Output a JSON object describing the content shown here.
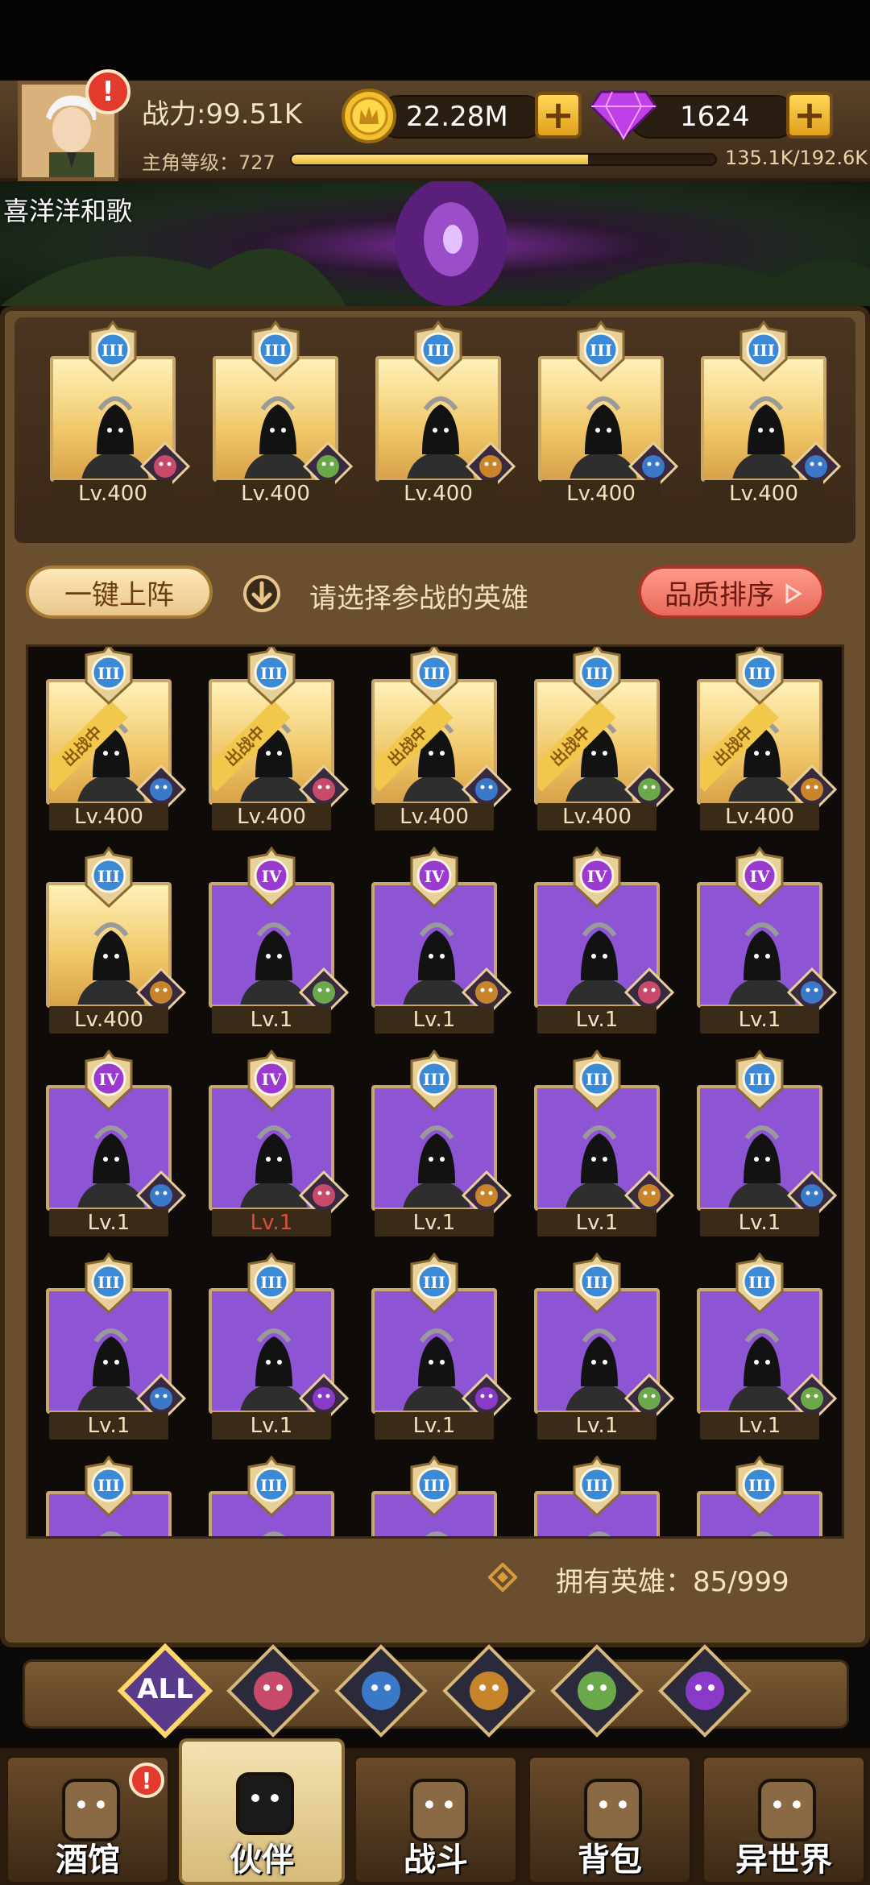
{
  "header": {
    "power": "战力:99.51K",
    "gold": "22.28M",
    "gems": "1624",
    "level_label": "主角等级：727",
    "xp_text": "135.1K/192.6K",
    "xp_fraction": 0.7,
    "player_name": "喜洋洋和歌"
  },
  "toolbar": {
    "auto_deploy": "一键上阵",
    "hint": "请选择参战的英雄",
    "sort": "品质排序"
  },
  "colors": {
    "gold_bg": "#f0c768",
    "purple_bg": "#8d55d4",
    "accent": "#e86a5a"
  },
  "deployed_tag": "出战中",
  "formation": [
    {
      "lv": "Lv.400",
      "rank": "III",
      "faction": "knight",
      "hero": "armored-knight"
    },
    {
      "lv": "Lv.400",
      "rank": "III",
      "faction": "elf",
      "hero": "elf-ranger"
    },
    {
      "lv": "Lv.400",
      "rank": "III",
      "faction": "beast",
      "hero": "pharaoh"
    },
    {
      "lv": "Lv.400",
      "rank": "III",
      "faction": "fishman",
      "hero": "serpent-shadow"
    },
    {
      "lv": "Lv.400",
      "rank": "III",
      "faction": "fishman",
      "hero": "blue-hair-mage"
    }
  ],
  "heroes": [
    {
      "lv": "Lv.400",
      "rank": "III",
      "bg": "gold",
      "deployed": true,
      "faction": "fishman",
      "hero": "serpent-shadow"
    },
    {
      "lv": "Lv.400",
      "rank": "III",
      "bg": "gold",
      "deployed": true,
      "faction": "knight",
      "hero": "armored-knight"
    },
    {
      "lv": "Lv.400",
      "rank": "III",
      "bg": "gold",
      "deployed": true,
      "faction": "fishman",
      "hero": "blue-hair-mage"
    },
    {
      "lv": "Lv.400",
      "rank": "III",
      "bg": "gold",
      "deployed": true,
      "faction": "elf",
      "hero": "elf-ranger"
    },
    {
      "lv": "Lv.400",
      "rank": "III",
      "bg": "gold",
      "deployed": true,
      "faction": "beast",
      "hero": "pharaoh"
    },
    {
      "lv": "Lv.400",
      "rank": "III",
      "bg": "gold",
      "deployed": false,
      "faction": "beast",
      "hero": "pharaoh"
    },
    {
      "lv": "Lv.1",
      "rank": "IV",
      "bg": "purple",
      "deployed": false,
      "faction": "elf",
      "hero": "stone-golem"
    },
    {
      "lv": "Lv.1",
      "rank": "IV",
      "bg": "purple",
      "deployed": false,
      "faction": "beast",
      "hero": "spiked-warrior"
    },
    {
      "lv": "Lv.1",
      "rank": "IV",
      "bg": "purple",
      "deployed": false,
      "faction": "knight",
      "hero": "feather-hat"
    },
    {
      "lv": "Lv.1",
      "rank": "IV",
      "bg": "purple",
      "deployed": false,
      "faction": "fishman",
      "hero": "blue-hood"
    },
    {
      "lv": "Lv.1",
      "rank": "IV",
      "bg": "purple",
      "deployed": false,
      "faction": "fishman",
      "hero": "blue-hood"
    },
    {
      "lv": "Lv.1",
      "rank": "IV",
      "bg": "purple",
      "deployed": false,
      "faction": "knight",
      "hero": "roman-soldier",
      "lv_red": true
    },
    {
      "lv": "Lv.1",
      "rank": "III",
      "bg": "purple",
      "deployed": false,
      "faction": "beast",
      "hero": "horse-warrior"
    },
    {
      "lv": "Lv.1",
      "rank": "III",
      "bg": "purple",
      "deployed": false,
      "faction": "beast",
      "hero": "horse-warrior"
    },
    {
      "lv": "Lv.1",
      "rank": "III",
      "bg": "purple",
      "deployed": false,
      "faction": "fishman",
      "hero": "long-hair-elder"
    },
    {
      "lv": "Lv.1",
      "rank": "III",
      "bg": "purple",
      "deployed": false,
      "faction": "fishman",
      "hero": "long-hair-elder"
    },
    {
      "lv": "Lv.1",
      "rank": "III",
      "bg": "purple",
      "deployed": false,
      "faction": "demon",
      "hero": "dark-knight"
    },
    {
      "lv": "Lv.1",
      "rank": "III",
      "bg": "purple",
      "deployed": false,
      "faction": "demon",
      "hero": "dark-knight"
    },
    {
      "lv": "Lv.1",
      "rank": "III",
      "bg": "purple",
      "deployed": false,
      "faction": "elf",
      "hero": "forest-hood"
    },
    {
      "lv": "Lv.1",
      "rank": "III",
      "bg": "purple",
      "deployed": false,
      "faction": "elf",
      "hero": "forest-hood"
    },
    {
      "lv": "",
      "rank": "III",
      "bg": "purple",
      "deployed": false,
      "faction": "beast",
      "hero": "horned"
    },
    {
      "lv": "",
      "rank": "III",
      "bg": "purple",
      "deployed": false,
      "faction": "knight",
      "hero": "horned"
    },
    {
      "lv": "",
      "rank": "III",
      "bg": "purple",
      "deployed": false,
      "faction": "fishman",
      "hero": "feather-hat"
    },
    {
      "lv": "",
      "rank": "III",
      "bg": "purple",
      "deployed": false,
      "faction": "beast",
      "hero": "red-crest"
    },
    {
      "lv": "",
      "rank": "III",
      "bg": "purple",
      "deployed": false,
      "faction": "beast",
      "hero": "red-crest"
    }
  ],
  "owned_text": "拥有英雄：85/999",
  "filters": [
    {
      "label": "ALL",
      "icon": "all-filter-icon"
    },
    {
      "label": "",
      "icon": "knight-faction-icon"
    },
    {
      "label": "",
      "icon": "fishman-faction-icon"
    },
    {
      "label": "",
      "icon": "beast-faction-icon"
    },
    {
      "label": "",
      "icon": "elf-faction-icon"
    },
    {
      "label": "",
      "icon": "demon-faction-icon"
    }
  ],
  "nav": [
    {
      "label": "酒馆",
      "icon": "beer-mug-icon",
      "alert": true
    },
    {
      "label": "伙伴",
      "icon": "partner-icon",
      "active": true
    },
    {
      "label": "战斗",
      "icon": "crossed-swords-icon"
    },
    {
      "label": "背包",
      "icon": "backpack-icon"
    },
    {
      "label": "异世界",
      "icon": "portal-icon"
    }
  ]
}
